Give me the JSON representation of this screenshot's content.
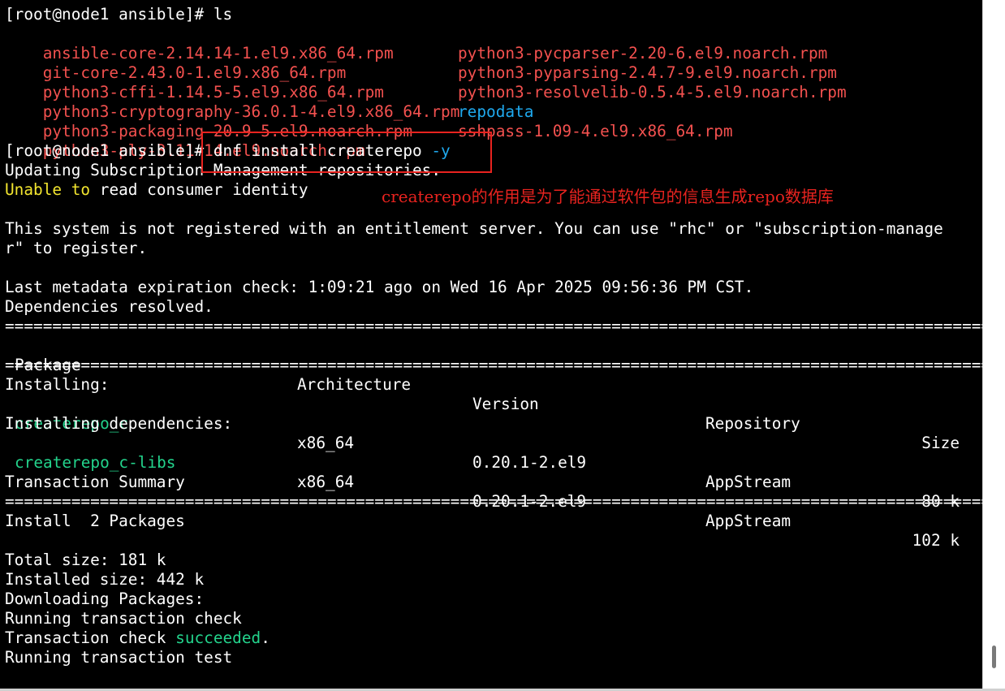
{
  "terminal": {
    "prompt": "[root@node1 ansible]# ",
    "cmd_ls": "ls",
    "cmd_dnf": "dnf install createrepo ",
    "cmd_flag": "-y",
    "files_left": [
      "ansible-core-2.14.14-1.el9.x86_64.rpm",
      "git-core-2.43.0-1.el9.x86_64.rpm",
      "python3-cffi-1.14.5-5.el9.x86_64.rpm",
      "python3-cryptography-36.0.1-4.el9.x86_64.rpm",
      "python3-packaging-20.9-5.el9.noarch.rpm",
      "python3-ply-3.11-14.el9.noarch.rpm"
    ],
    "files_right": [
      "python3-pycparser-2.20-6.el9.noarch.rpm",
      "python3-pyparsing-2.4.7-9.el9.noarch.rpm",
      "python3-resolvelib-0.5.4-5.el9.noarch.rpm",
      "repodata",
      "sshpass-1.09-4.el9.x86_64.rpm"
    ],
    "updating": "Updating Subscription Management repositories.",
    "unable": "Unable",
    "to": "to",
    "unable_rest": " read consumer identity",
    "not_registered_1": "This system is not registered with an entitlement server. You can use \"rhc\" or \"subscription-manage",
    "not_registered_2": "r\" to register.",
    "metadata": "Last metadata expiration check: 1:09:21 ago on Wed 16 Apr 2025 09:56:36 PM CST.",
    "deps_resolved": "Dependencies resolved.",
    "separator": "=============================================================================================================================",
    "headers": {
      "package": "Package",
      "architecture": "Architecture",
      "version": "Version",
      "repository": "Repository",
      "size": "Size"
    },
    "installing": "Installing:",
    "installing_deps": "Installing dependencies:",
    "packages": [
      {
        "name": "createrepo_c",
        "arch": "x86_64",
        "version": "0.20.1-2.el9",
        "repo": "AppStream",
        "size": "80 k"
      },
      {
        "name": "createrepo_c-libs",
        "arch": "x86_64",
        "version": "0.20.1-2.el9",
        "repo": "AppStream",
        "size": "102 k"
      }
    ],
    "tx_summary": "Transaction Summary",
    "install_count": "Install  2 Packages",
    "total_size": "Total size: 181 k",
    "installed_size": "Installed size: 442 k",
    "downloading": "Downloading Packages:",
    "running_check": "Running transaction check",
    "tx_check": "Transaction check ",
    "succeeded": "succeeded",
    "period": ".",
    "running_test": "Running transaction test"
  },
  "annotation": {
    "note": "createrepo的作用是为了能通过软件包的信息生成repo数据库"
  },
  "colors": {
    "background": "#000000",
    "file_red": "#f3514f",
    "dir_blue": "#1fa9ee",
    "package_green": "#23d38c",
    "warning_yellow": "#f2e52f",
    "annotation_red": "#e8231f"
  }
}
